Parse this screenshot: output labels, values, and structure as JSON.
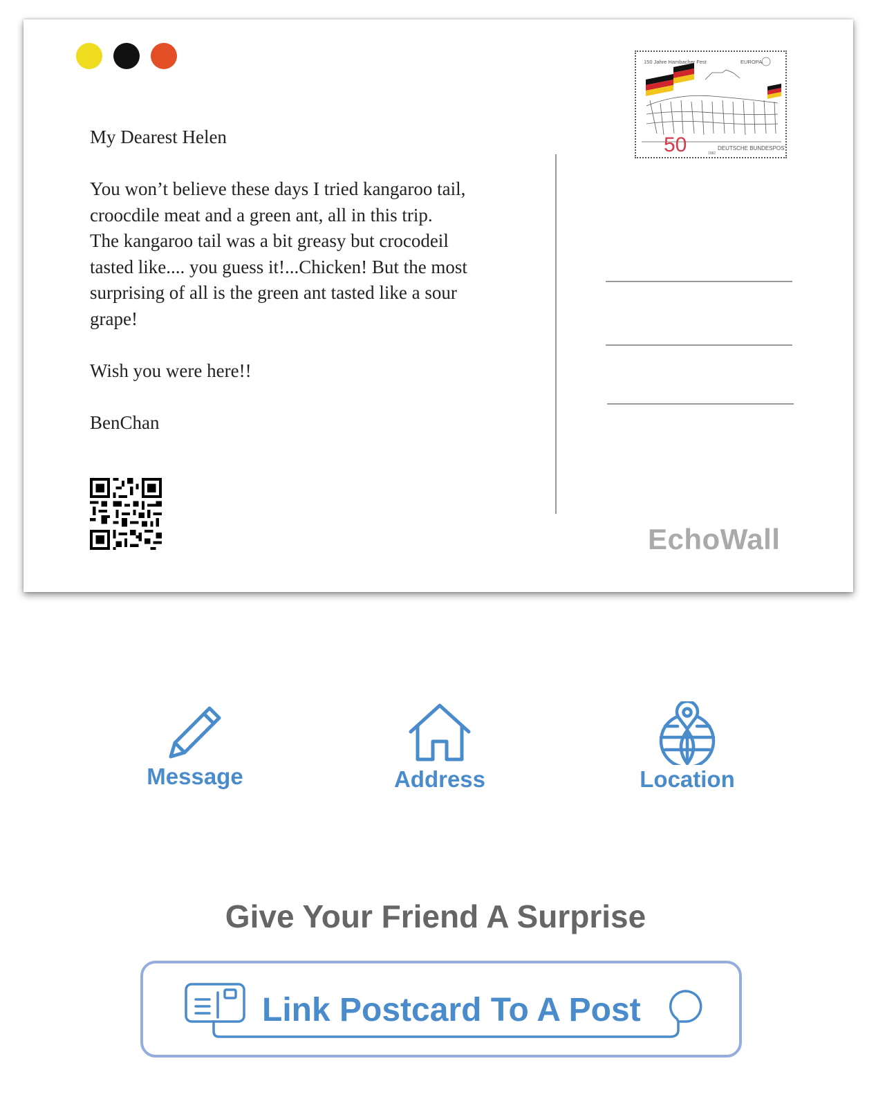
{
  "colors": {
    "dot_yellow": "#f0dc1e",
    "dot_black": "#111111",
    "dot_orange": "#e24e25",
    "accent": "#4a8ccb",
    "button_border": "#93aedc"
  },
  "postcard": {
    "letter": {
      "greeting": "My Dearest Helen",
      "body_lines": [
        "You won’t believe these days I tried kangaroo tail,",
        "croocdile meat and a green ant, all in this trip.",
        "The kangaroo tail was a bit greasy but crocodeil",
        "tasted like.... you guess it!...Chicken! But the most",
        "surprising of  all is the green ant tasted like a sour",
        "grape!"
      ],
      "closing": "Wish you were here!!",
      "signature": "BenChan"
    },
    "stamp": {
      "top_text": "150 Jahre Hambacher Fest",
      "corner_text": "EUROPA",
      "value": "50",
      "year": "1982",
      "issuer": "DEUTSCHE BUNDESPOST"
    },
    "brand": "EchoWall"
  },
  "actions": [
    {
      "label": "Message",
      "icon": "pencil-icon"
    },
    {
      "label": "Address",
      "icon": "house-icon"
    },
    {
      "label": "Location",
      "icon": "globe-pin-icon"
    }
  ],
  "tagline": "Give Your Friend A Surprise",
  "link_button": {
    "label": "Link Postcard To A Post",
    "icon": "postcard-icon"
  }
}
